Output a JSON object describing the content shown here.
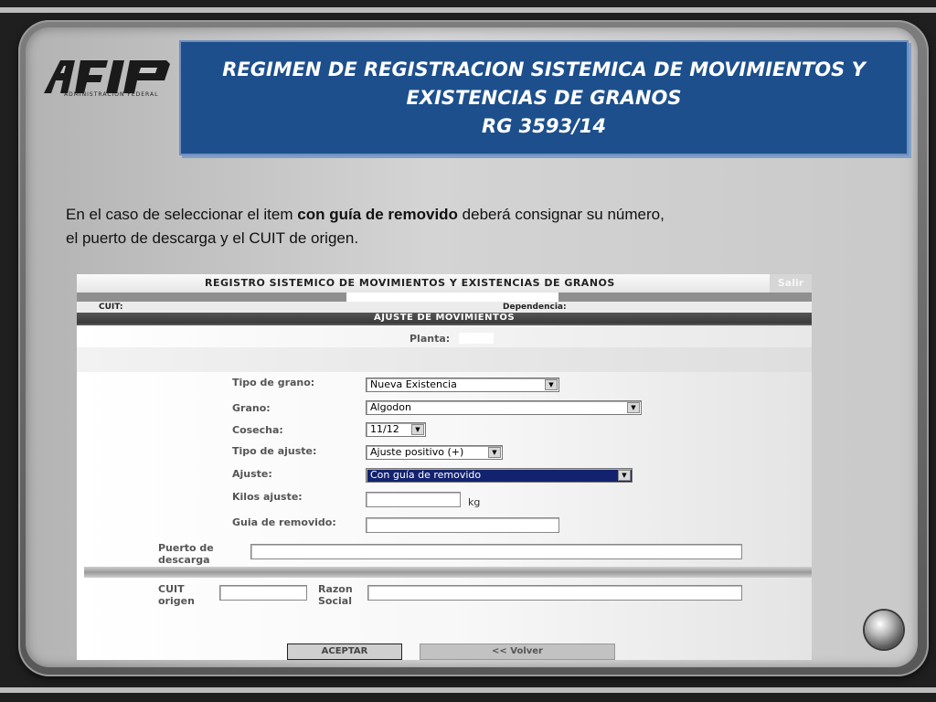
{
  "slide": {
    "title_lines": [
      "REGIMEN DE REGISTRACION SISTEMICA DE MOVIMIENTOS Y",
      "EXISTENCIAS DE GRANOS",
      "RG  3593/14"
    ],
    "logo_text": "AFIP",
    "logo_subtitle": "ADMINISTRACION FEDERAL",
    "intro_before": "En el caso de seleccionar el item ",
    "intro_bold": "con guía de removido",
    "intro_after": " deberá  consignar su  número,",
    "intro_line2": "el puerto de descarga y  el CUIT de origen."
  },
  "app": {
    "title": "REGISTRO SISTEMICO DE MOVIMIENTOS Y EXISTENCIAS DE GRANOS",
    "salir_label": "Salir",
    "cuit_label": "CUIT:",
    "dependencia_label": "Dependencia:",
    "section_title": "AJUSTE DE MOVIMIENTOS",
    "planta_label": "Planta:",
    "fields": {
      "tipo_grano": {
        "label": "Tipo de grano:",
        "value": "Nueva Existencia"
      },
      "grano": {
        "label": "Grano:",
        "value": "Algodon"
      },
      "cosecha": {
        "label": "Cosecha:",
        "value": "11/12"
      },
      "tipo_ajuste": {
        "label": "Tipo de ajuste:",
        "value": "Ajuste positivo (+)"
      },
      "ajuste": {
        "label": "Ajuste:",
        "value": "Con guía de removido"
      },
      "kilos_ajuste": {
        "label": "Kilos ajuste:",
        "value": "",
        "unit": "kg"
      },
      "guia_removido": {
        "label": "Guia de removido:",
        "value": ""
      },
      "puerto_descarga": {
        "label_line1": "Puerto de",
        "label_line2": "descarga",
        "value": ""
      },
      "cuit_origen": {
        "label_line1": "CUIT",
        "label_line2": "origen",
        "value": ""
      },
      "razon_social": {
        "label_line1": "Razon",
        "label_line2": "Social",
        "value": ""
      }
    },
    "buttons": {
      "accept": "ACEPTAR",
      "back": "<< Volver"
    }
  },
  "colors": {
    "title_box": "#1d4f8c",
    "selected_option": "#13226e"
  },
  "icons": {
    "arrow": "▼"
  }
}
